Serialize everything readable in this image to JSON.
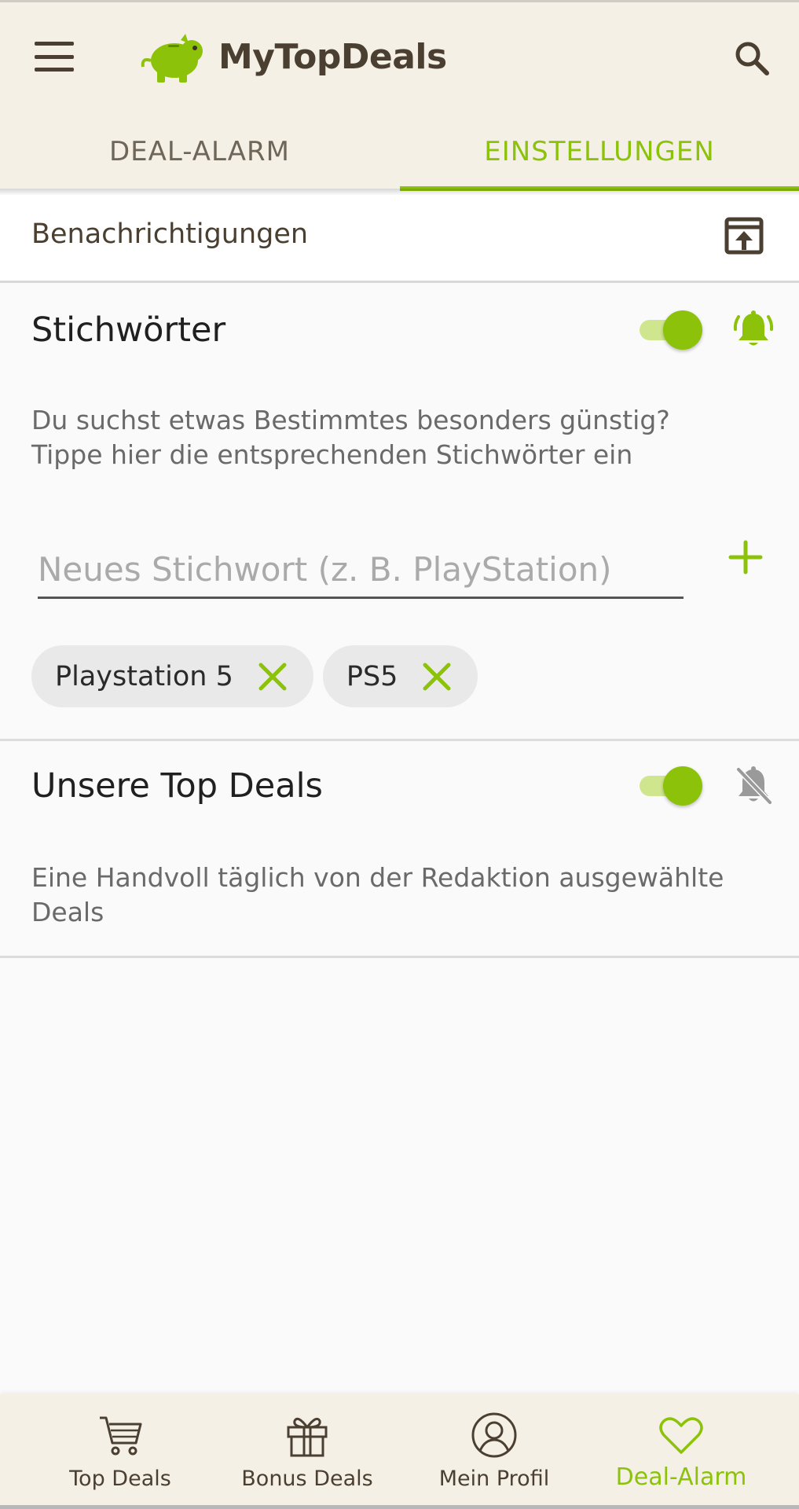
{
  "app": {
    "title": "MyTopDeals"
  },
  "tabs": [
    {
      "label": "DEAL-ALARM",
      "active": false
    },
    {
      "label": "EINSTELLUNGEN",
      "active": true
    }
  ],
  "notifications": {
    "title": "Benachrichtigungen"
  },
  "keywords": {
    "title": "Stichwörter",
    "enabled": true,
    "bell": "bell-ringing-icon",
    "description_line1": "Du suchst etwas Bestimmtes besonders günstig?",
    "description_line2": "Tippe hier die entsprechenden Stichwörter ein",
    "input_placeholder": "Neues Stichwort (z. B. PlayStation)",
    "input_value": "",
    "chips": [
      {
        "label": "Playstation 5"
      },
      {
        "label": "PS5"
      }
    ]
  },
  "top_deals": {
    "title": "Unsere Top Deals",
    "enabled": true,
    "bell": "bell-off-icon",
    "description_line1": "Eine Handvoll täglich von der Redaktion ausgewählte",
    "description_line2": "Deals"
  },
  "bottom_nav": [
    {
      "label": "Top Deals",
      "icon": "cart-icon",
      "active": false
    },
    {
      "label": "Bonus Deals",
      "icon": "gift-icon",
      "active": false
    },
    {
      "label": "Mein Profil",
      "icon": "profile-icon",
      "active": false
    },
    {
      "label": "Deal-Alarm",
      "icon": "heart-icon",
      "active": true
    }
  ],
  "colors": {
    "accent": "#8cc20a",
    "header_bg": "#f5f0e6",
    "text_dark": "#4a3f30"
  }
}
